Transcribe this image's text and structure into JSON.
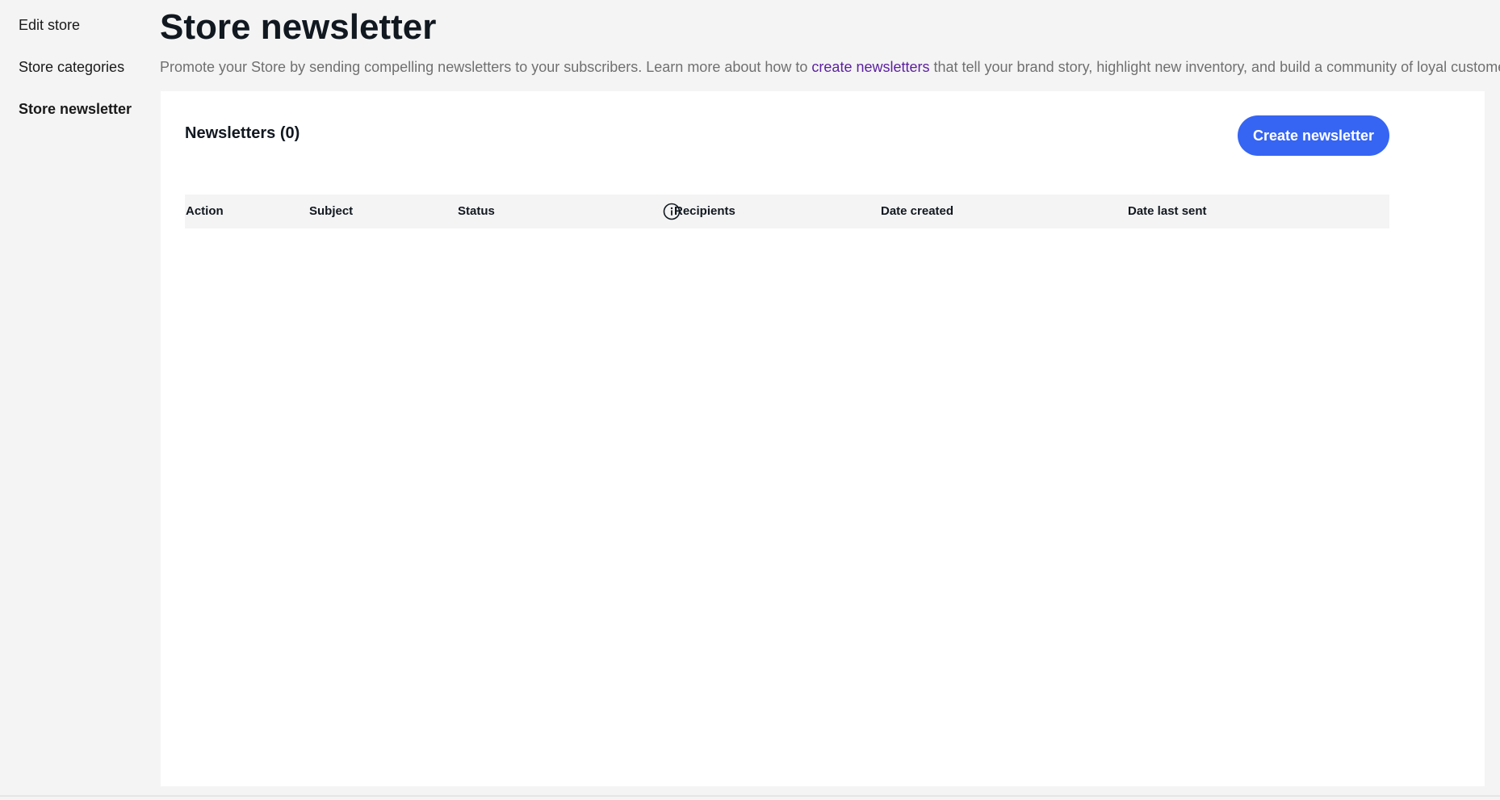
{
  "sidebar": {
    "items": [
      {
        "label": "Edit store"
      },
      {
        "label": "Store categories"
      },
      {
        "label": "Store newsletter",
        "active": true
      }
    ]
  },
  "header": {
    "title": "Store newsletter",
    "intro_before": "Promote your Store by sending compelling newsletters to your subscribers. Learn more about how to ",
    "intro_link": "create newsletters",
    "intro_after": " that tell your brand story, highlight new inventory, and build a community of loyal customers."
  },
  "panel": {
    "title": "Newsletters (0)",
    "create_button": "Create newsletter",
    "columns": [
      "Action",
      "Subject",
      "Status",
      "Recipients",
      "Date created",
      "Date last sent"
    ],
    "status_info_icon": "info-circle-icon",
    "rows": []
  },
  "colors": {
    "page_bg": "#f4f4f4",
    "panel_bg": "#ffffff",
    "primary_button": "#3665f3",
    "link": "#5b1f9e",
    "muted_text": "#707070"
  }
}
